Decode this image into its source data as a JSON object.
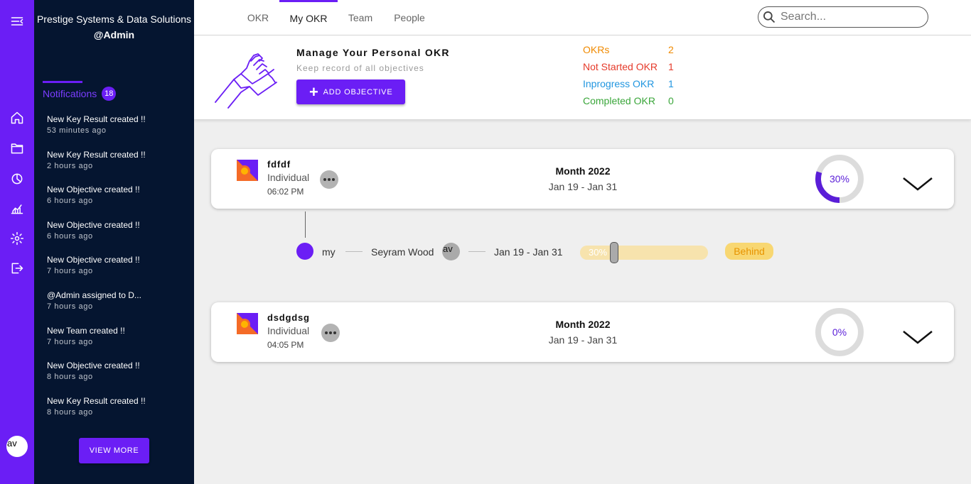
{
  "org": {
    "name": "Prestige Systems & Data Solutions",
    "user": "@Admin"
  },
  "rail": {
    "icons": [
      "collapse-menu-icon",
      "home-icon",
      "folder-icon",
      "pie-chart-icon",
      "analytics-icon",
      "settings-icon",
      "logout-icon"
    ],
    "avatar": "av"
  },
  "notifications": {
    "title": "Notifications",
    "count": "18",
    "items": [
      {
        "text": "New Key Result created !!",
        "time": "53 minutes ago"
      },
      {
        "text": "New Key Result created !!",
        "time": "2 hours ago"
      },
      {
        "text": "New Objective created !!",
        "time": "6 hours ago"
      },
      {
        "text": "New Objective created !!",
        "time": "6 hours ago"
      },
      {
        "text": "New Objective created !!",
        "time": "7 hours ago"
      },
      {
        "text": "@Admin assigned to D...",
        "time": "7 hours ago"
      },
      {
        "text": "New Team created !!",
        "time": "7 hours ago"
      },
      {
        "text": "New Objective created !!",
        "time": "8 hours ago"
      },
      {
        "text": "New Key Result created !!",
        "time": "8 hours ago"
      }
    ],
    "view_more": "VIEW MORE"
  },
  "tabs": [
    {
      "label": "OKR",
      "active": false
    },
    {
      "label": "My OKR",
      "active": true
    },
    {
      "label": "Team",
      "active": false
    },
    {
      "label": "People",
      "active": false
    }
  ],
  "search": {
    "placeholder": "Search..."
  },
  "header": {
    "title": "Manage Your Personal OKR",
    "subtitle": "Keep record of all objectives",
    "add_button": "ADD OBJECTIVE",
    "stats": [
      {
        "label": "OKRs",
        "value": "2",
        "color": "#f08a00"
      },
      {
        "label": "Not Started OKR",
        "value": "1",
        "color": "#e53a2a"
      },
      {
        "label": "Inprogress OKR",
        "value": "1",
        "color": "#2196e0"
      },
      {
        "label": "Completed OKR",
        "value": "0",
        "color": "#3aa63a"
      }
    ]
  },
  "objectives": [
    {
      "name": "fdfdf",
      "kind": "Individual",
      "time": "06:02 PM",
      "period": "Month 2022",
      "range": "Jan 19 - Jan 31",
      "progress_label": "30%",
      "progress": 0.3
    },
    {
      "name": "dsdgdsg",
      "kind": "Individual",
      "time": "04:05 PM",
      "period": "Month 2022",
      "range": "Jan 19 - Jan 31",
      "progress_label": "0%",
      "progress": 0
    }
  ],
  "key_result": {
    "name": "my",
    "owner": "Seyram Wood",
    "owner_avatar": "av",
    "range": "Jan 19 - Jan 31",
    "progress_label": "30%",
    "progress": 0.3,
    "status": "Behind"
  }
}
